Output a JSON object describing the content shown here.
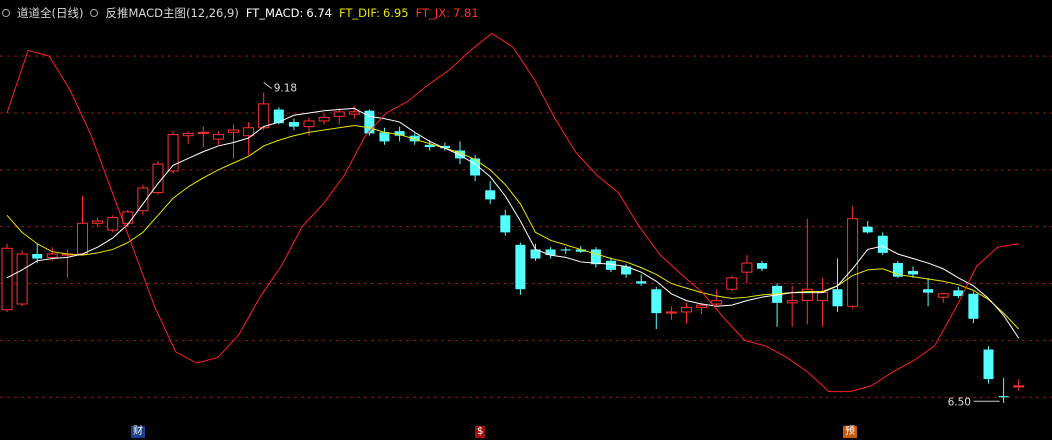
{
  "header": {
    "stock_name": "道道全",
    "period": "(日线)",
    "indicator": "反推MACD主图(12,26,9)",
    "ft_macd_label": "FT_MACD:",
    "ft_macd_value": "6.74",
    "ft_dif_label": "FT_DIF:",
    "ft_dif_value": "6.95",
    "ft_jx_label": "FT_JX:",
    "ft_jx_value": "7.81"
  },
  "colors": {
    "up": "#ff3232",
    "down": "#54ffff",
    "white_line": "#ffffff",
    "yellow_line": "#e6e600",
    "red_line": "#ff2020",
    "grid": "#8b1a1a",
    "ft_macd": "#ffffff",
    "ft_dif": "#e6e600",
    "ft_jx": "#ff3030"
  },
  "markers": [
    {
      "label": "财",
      "bg": "#1c3f8c"
    },
    {
      "label": "$",
      "bg": "#a01010"
    },
    {
      "label": "预",
      "bg": "#c25a12"
    }
  ],
  "chart_data": {
    "type": "candlestick",
    "ylim": [
      6.3,
      9.8
    ],
    "gridlines": [
      6.5,
      7.0,
      7.5,
      8.0,
      8.5,
      9.0,
      9.5
    ],
    "annotations": [
      {
        "text": "9.18",
        "candle_index": 17,
        "value": 9.18
      },
      {
        "text": "6.50",
        "candle_index": 66,
        "value": 6.5
      }
    ],
    "candles": [
      [
        7.27,
        7.81,
        7.85,
        7.25
      ],
      [
        7.32,
        7.76,
        7.79,
        7.3
      ],
      [
        7.76,
        7.72,
        7.85,
        7.68
      ],
      [
        7.73,
        7.76,
        7.82,
        7.7
      ],
      [
        7.75,
        7.76,
        7.8,
        7.55
      ],
      [
        7.76,
        8.03,
        8.27,
        7.75
      ],
      [
        8.03,
        8.05,
        8.08,
        8.0
      ],
      [
        7.97,
        8.08,
        8.1,
        7.95
      ],
      [
        8.03,
        8.13,
        8.15,
        8.0
      ],
      [
        8.14,
        8.34,
        8.37,
        8.1
      ],
      [
        8.3,
        8.55,
        8.58,
        8.28
      ],
      [
        8.49,
        8.81,
        8.84,
        8.47
      ],
      [
        8.8,
        8.82,
        8.84,
        8.73
      ],
      [
        8.82,
        8.83,
        8.88,
        8.7
      ],
      [
        8.77,
        8.81,
        8.84,
        8.72
      ],
      [
        8.83,
        8.85,
        8.9,
        8.6
      ],
      [
        8.8,
        8.87,
        8.92,
        8.63
      ],
      [
        8.87,
        9.08,
        9.18,
        8.85
      ],
      [
        9.03,
        8.91,
        9.05,
        8.9
      ],
      [
        8.92,
        8.88,
        8.95,
        8.85
      ],
      [
        8.88,
        8.93,
        8.96,
        8.8
      ],
      [
        8.93,
        8.96,
        8.99,
        8.9
      ],
      [
        8.97,
        9.01,
        9.04,
        8.9
      ],
      [
        8.99,
        9.01,
        9.06,
        8.95
      ],
      [
        9.02,
        8.82,
        9.03,
        8.8
      ],
      [
        8.83,
        8.75,
        8.87,
        8.72
      ],
      [
        8.84,
        8.8,
        8.88,
        8.75
      ],
      [
        8.8,
        8.75,
        8.82,
        8.72
      ],
      [
        8.72,
        8.7,
        8.76,
        8.67
      ],
      [
        8.71,
        8.69,
        8.74,
        8.67
      ],
      [
        8.67,
        8.6,
        8.75,
        8.55
      ],
      [
        8.6,
        8.45,
        8.63,
        8.4
      ],
      [
        8.32,
        8.24,
        8.4,
        8.2
      ],
      [
        8.1,
        7.95,
        8.15,
        7.92
      ],
      [
        7.84,
        7.45,
        7.86,
        7.4
      ],
      [
        7.8,
        7.72,
        7.85,
        7.7
      ],
      [
        7.8,
        7.75,
        7.82,
        7.72
      ],
      [
        7.8,
        7.79,
        7.82,
        7.76
      ],
      [
        7.8,
        7.78,
        7.83,
        7.77
      ],
      [
        7.8,
        7.67,
        7.82,
        7.64
      ],
      [
        7.7,
        7.62,
        7.73,
        7.6
      ],
      [
        7.65,
        7.58,
        7.67,
        7.55
      ],
      [
        7.52,
        7.5,
        7.58,
        7.48
      ],
      [
        7.45,
        7.24,
        7.47,
        7.1
      ],
      [
        7.24,
        7.25,
        7.3,
        7.18
      ],
      [
        7.25,
        7.29,
        7.33,
        7.15
      ],
      [
        7.29,
        7.31,
        7.33,
        7.23
      ],
      [
        7.32,
        7.35,
        7.45,
        7.3
      ],
      [
        7.45,
        7.55,
        7.57,
        7.43
      ],
      [
        7.6,
        7.68,
        7.75,
        7.5
      ],
      [
        7.68,
        7.63,
        7.7,
        7.61
      ],
      [
        7.48,
        7.33,
        7.5,
        7.12
      ],
      [
        7.33,
        7.35,
        7.48,
        7.12
      ],
      [
        7.35,
        7.45,
        8.07,
        7.14
      ],
      [
        7.35,
        7.42,
        7.55,
        7.12
      ],
      [
        7.45,
        7.3,
        7.72,
        7.25
      ],
      [
        7.3,
        8.07,
        8.18,
        7.28
      ],
      [
        8.0,
        7.95,
        8.05,
        7.94
      ],
      [
        7.92,
        7.77,
        7.95,
        7.75
      ],
      [
        7.68,
        7.56,
        7.7,
        7.55
      ],
      [
        7.61,
        7.58,
        7.65,
        7.55
      ],
      [
        7.45,
        7.42,
        7.55,
        7.3
      ],
      [
        7.38,
        7.41,
        7.42,
        7.33
      ],
      [
        7.44,
        7.39,
        7.47,
        7.37
      ],
      [
        7.41,
        7.19,
        7.43,
        7.15
      ],
      [
        6.92,
        6.66,
        6.95,
        6.62
      ],
      [
        6.51,
        6.5,
        6.67,
        6.45
      ],
      [
        6.6,
        6.6,
        6.66,
        6.56
      ]
    ],
    "white_line": [
      7.55,
      7.62,
      7.7,
      7.72,
      7.73,
      7.76,
      7.82,
      7.9,
      8.02,
      8.2,
      8.38,
      8.54,
      8.6,
      8.66,
      8.71,
      8.74,
      8.78,
      8.88,
      8.92,
      8.98,
      9.0,
      9.02,
      9.03,
      9.04,
      8.97,
      8.95,
      8.92,
      8.83,
      8.75,
      8.69,
      8.63,
      8.55,
      8.44,
      8.27,
      8.05,
      7.8,
      7.75,
      7.73,
      7.69,
      7.68,
      7.67,
      7.65,
      7.6,
      7.52,
      7.41,
      7.35,
      7.32,
      7.3,
      7.31,
      7.35,
      7.38,
      7.4,
      7.42,
      7.42,
      7.42,
      7.48,
      7.63,
      7.8,
      7.83,
      7.76,
      7.72,
      7.68,
      7.63,
      7.55,
      7.48,
      7.37,
      7.22,
      7.02
    ],
    "yellow_line": [
      8.1,
      7.95,
      7.85,
      7.78,
      7.76,
      7.75,
      7.77,
      7.8,
      7.86,
      7.95,
      8.1,
      8.25,
      8.35,
      8.43,
      8.5,
      8.56,
      8.62,
      8.71,
      8.76,
      8.8,
      8.83,
      8.85,
      8.87,
      8.89,
      8.87,
      8.83,
      8.81,
      8.77,
      8.73,
      8.69,
      8.65,
      8.59,
      8.5,
      8.37,
      8.2,
      7.95,
      7.88,
      7.84,
      7.8,
      7.76,
      7.72,
      7.69,
      7.64,
      7.58,
      7.5,
      7.46,
      7.42,
      7.39,
      7.37,
      7.38,
      7.4,
      7.41,
      7.42,
      7.43,
      7.43,
      7.48,
      7.57,
      7.62,
      7.63,
      7.58,
      7.56,
      7.54,
      7.52,
      7.49,
      7.44,
      7.36,
      7.24,
      7.1
    ],
    "red_line": [
      9.0,
      9.55,
      9.5,
      9.2,
      8.8,
      8.3,
      7.8,
      7.3,
      6.9,
      6.8,
      6.85,
      7.05,
      7.38,
      7.65,
      8.0,
      8.2,
      8.45,
      8.8,
      9.0,
      9.1,
      9.25,
      9.38,
      9.55,
      9.7,
      9.58,
      9.3,
      8.95,
      8.65,
      8.45,
      8.3,
      8.0,
      7.75,
      7.58,
      7.42,
      7.2,
      7.0,
      6.95,
      6.85,
      6.72,
      6.55,
      6.55,
      6.6,
      6.72,
      6.82,
      6.95,
      7.28,
      7.65,
      7.82,
      7.85
    ]
  }
}
